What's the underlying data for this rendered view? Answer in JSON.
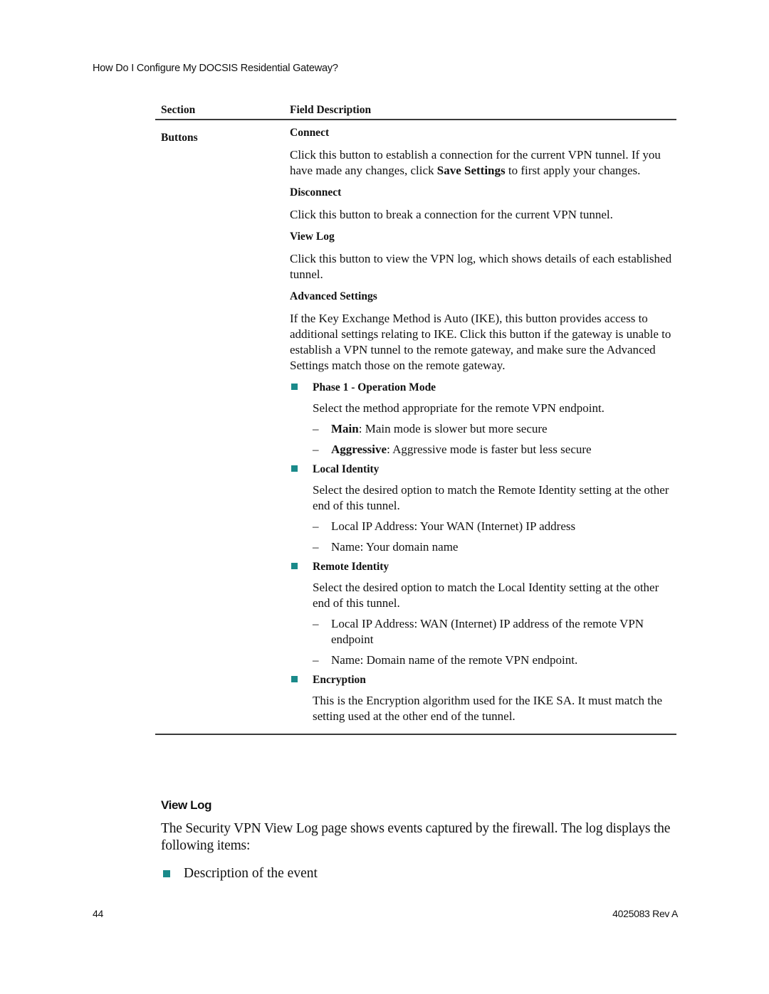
{
  "header": {
    "running_title": "How Do I Configure My DOCSIS Residential Gateway?"
  },
  "table": {
    "columns": [
      "Section",
      "Field Description"
    ],
    "section": "Buttons",
    "items": [
      {
        "title": "Connect",
        "text_before": "Click this button to establish a connection for the current VPN tunnel. If you have made any changes, click ",
        "text_bold": "Save Settings",
        "text_after": " to first apply your changes."
      },
      {
        "title": "Disconnect",
        "text": "Click this button to break a connection for the current VPN tunnel."
      },
      {
        "title": "View Log",
        "text": "Click this button to view the VPN log, which shows details of each established tunnel."
      },
      {
        "title": "Advanced Settings",
        "text": "If the Key Exchange Method is Auto (IKE), this button provides access to additional settings relating to IKE. Click this button if the gateway is unable to establish a VPN tunnel to the remote gateway, and make sure the Advanced Settings match those on the remote gateway."
      }
    ],
    "advanced_bullets": [
      {
        "title": "Phase 1 - Operation Mode",
        "text": "Select the method appropriate for the remote VPN endpoint.",
        "subitems": [
          {
            "label": "Main",
            "text": ": Main mode is slower but more secure"
          },
          {
            "label": "Aggressive",
            "text": ": Aggressive mode is faster but less secure"
          }
        ]
      },
      {
        "title": "Local Identity",
        "text": "Select the desired option to match the Remote Identity setting at the other end of this tunnel.",
        "subitems": [
          {
            "text": "Local IP Address: Your WAN (Internet) IP address"
          },
          {
            "text": "Name: Your domain name"
          }
        ]
      },
      {
        "title": "Remote Identity",
        "text": "Select the desired option to match the Local Identity setting at the other end of this tunnel.",
        "subitems": [
          {
            "text": "Local IP Address: WAN (Internet) IP address of the remote VPN endpoint"
          },
          {
            "text": "Name: Domain name of the remote VPN endpoint."
          }
        ]
      },
      {
        "title": "Encryption",
        "text": "This is the Encryption algorithm used for the IKE SA. It must match the setting used at the other end of the tunnel."
      }
    ]
  },
  "view_log": {
    "heading": "View Log",
    "body": "The Security VPN View Log page shows events captured by the firewall. The log displays the following items:",
    "bullets": [
      "Description of the event"
    ]
  },
  "footer": {
    "page_number": "44",
    "doc_id": "4025083 Rev A"
  },
  "colors": {
    "bullet": "#1a8a8a",
    "rule": "#3a3a3a"
  },
  "symbols": {
    "dash": "–"
  }
}
